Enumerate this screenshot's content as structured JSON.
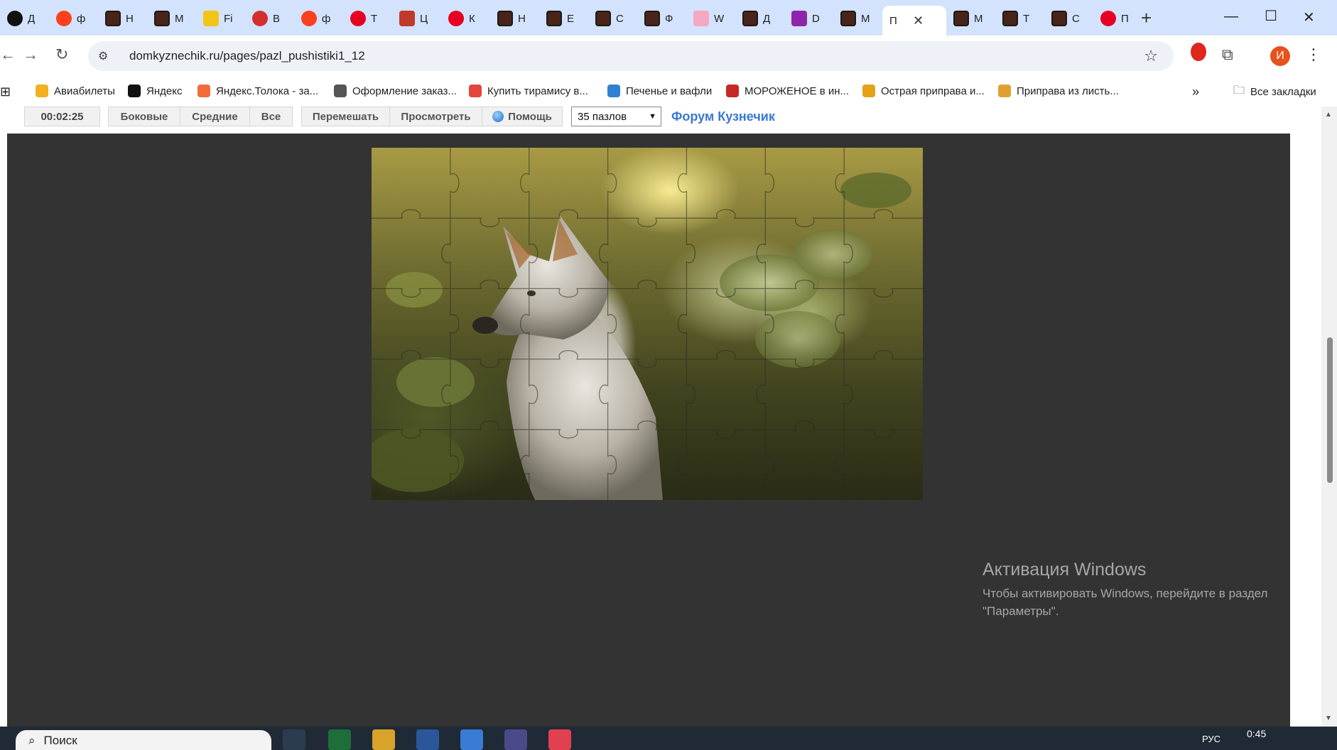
{
  "browser": {
    "tabs": [
      {
        "label": "Д",
        "icon": "yandex-plus-icon",
        "style": "dark"
      },
      {
        "label": "ф",
        "icon": "yandex-icon",
        "style": "ya"
      },
      {
        "label": "Н",
        "icon": "site-favicon-icon",
        "style": "brown"
      },
      {
        "label": "М",
        "icon": "site-favicon-icon",
        "style": "brown"
      },
      {
        "label": "Fi",
        "icon": "yellow-favicon-icon",
        "style": "yellow"
      },
      {
        "label": "В",
        "icon": "red-favicon-icon",
        "style": "red"
      },
      {
        "label": "ф",
        "icon": "yandex-icon",
        "style": "ya"
      },
      {
        "label": "Т",
        "icon": "pinterest-icon",
        "style": "pin"
      },
      {
        "label": "Ц",
        "icon": "star-favicon-icon",
        "style": "star"
      },
      {
        "label": "К",
        "icon": "pinterest-icon",
        "style": "pin"
      },
      {
        "label": "Н",
        "icon": "site-favicon-icon",
        "style": "brown"
      },
      {
        "label": "Е",
        "icon": "site-favicon-icon",
        "style": "brown"
      },
      {
        "label": "С",
        "icon": "site-favicon-icon",
        "style": "brown"
      },
      {
        "label": "Ф",
        "icon": "site-favicon-icon",
        "style": "brown"
      },
      {
        "label": "W",
        "icon": "pink-favicon-icon",
        "style": "pink"
      },
      {
        "label": "Д",
        "icon": "site-favicon-icon",
        "style": "brown"
      },
      {
        "label": "D",
        "icon": "purple-favicon-icon",
        "style": "purple"
      },
      {
        "label": "М",
        "icon": "site-favicon-icon",
        "style": "brown"
      },
      {
        "label": "П",
        "icon": "",
        "style": "active"
      },
      {
        "label": "М",
        "icon": "site-favicon-icon",
        "style": "brown"
      },
      {
        "label": "Т",
        "icon": "site-favicon-icon",
        "style": "brown"
      },
      {
        "label": "С",
        "icon": "site-favicon-icon",
        "style": "brown"
      },
      {
        "label": "П",
        "icon": "pinterest-icon",
        "style": "pin"
      }
    ],
    "url": "domkyznechik.ru/pages/pazl_pushistiki1_12",
    "avatar_letter": "И",
    "bookmarks": [
      {
        "label": "Авиабилеты",
        "color": "#f2b01e"
      },
      {
        "label": "Яндекс",
        "color": "#111111"
      },
      {
        "label": "Яндекс.Толока - за...",
        "color": "#f26b3a"
      },
      {
        "label": "Оформление заказ...",
        "color": "#555555"
      },
      {
        "label": "Купить тирамису в...",
        "color": "#e0463c"
      },
      {
        "label": "Печенье и вафли",
        "color": "#2f80d1"
      },
      {
        "label": "МОРОЖЕНОЕ в ин...",
        "color": "#c62828"
      },
      {
        "label": "Острая приправа и...",
        "color": "#e3a21a"
      },
      {
        "label": "Приправа из листь...",
        "color": "#e0a030"
      }
    ],
    "all_bookmarks": "Все закладки",
    "more_bookmarks": "»"
  },
  "page": {
    "timer": "00:02:25",
    "edge_button": "Боковые",
    "middle_button": "Средние",
    "all_button": "Все",
    "shuffle_button": "Перемешать",
    "preview_button": "Просмотреть",
    "help_button": "Помощь",
    "pieces_select": "35 пазлов",
    "forum_link": "Форум Кузнечик",
    "puzzle_grid": {
      "cols": 7,
      "rows": 5
    }
  },
  "watermark": {
    "title": "Активация Windows",
    "line1": "Чтобы активировать Windows, перейдите в раздел",
    "line2": "\"Параметры\"."
  },
  "taskbar": {
    "search_label": "Поиск",
    "lang": "РУС",
    "time": "0:45"
  },
  "colors": {
    "tabstrip": "#d3e3fd",
    "stage": "#333333",
    "link": "#3a78d6"
  }
}
